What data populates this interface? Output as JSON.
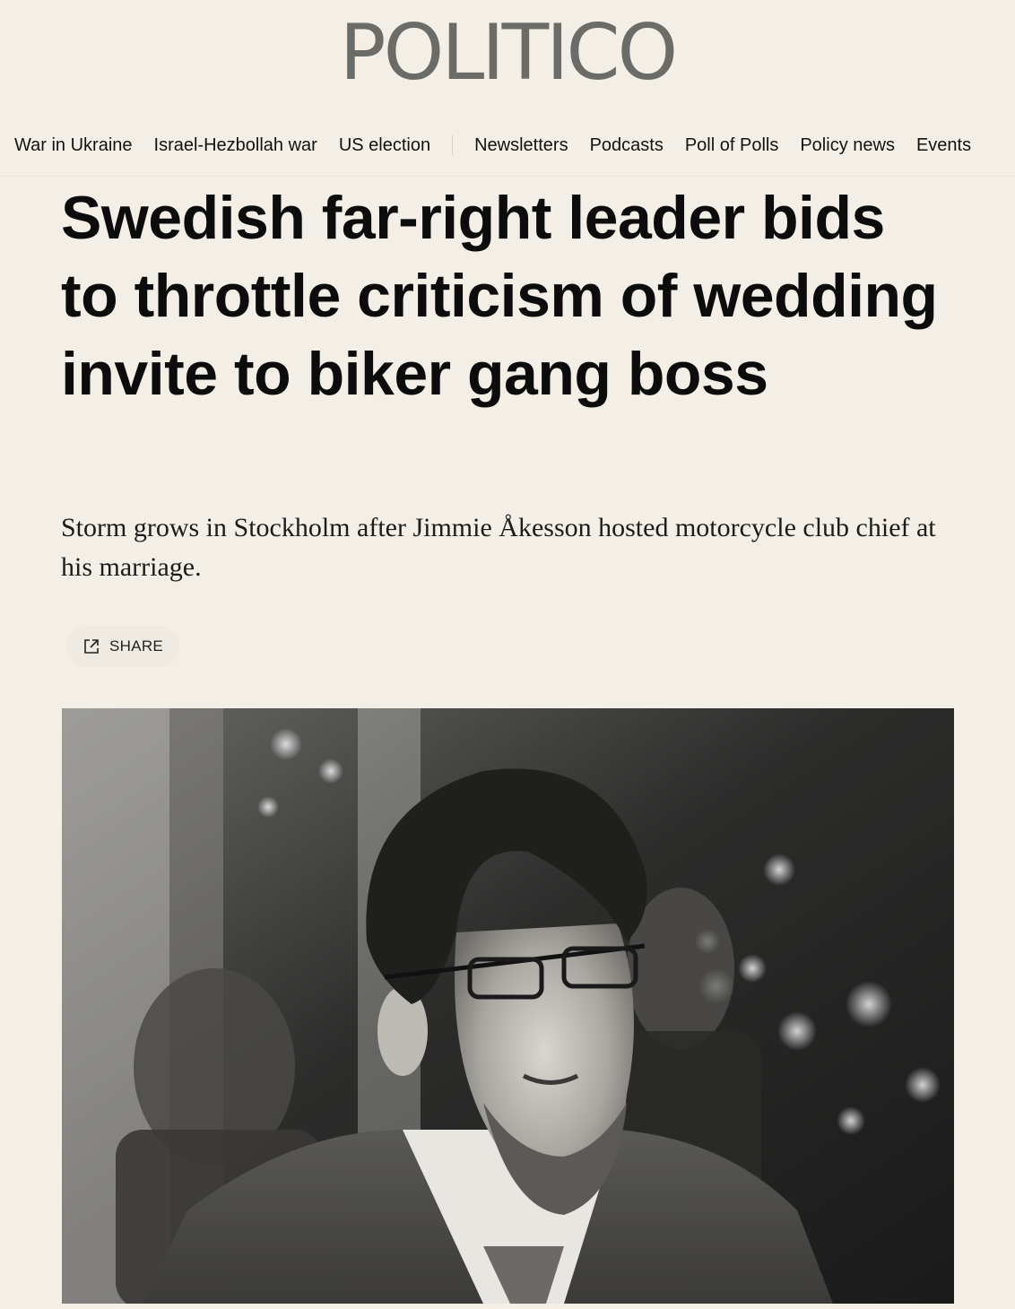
{
  "brand": {
    "logo": "POLITICO"
  },
  "nav": {
    "items": [
      "War in Ukraine",
      "Israel-Hezbollah war",
      "US election"
    ],
    "secondary_items": [
      "Newsletters",
      "Podcasts",
      "Poll of Polls",
      "Policy news",
      "Events"
    ]
  },
  "article": {
    "headline": "Swedish far-right leader bids to throttle criticism of wedding invite to biker gang boss",
    "dek": "Storm grows in Stockholm after Jimmie Åkesson hosted motorcycle club chief at his marriage.",
    "share_label": "SHARE"
  },
  "icons": {
    "share": "share-external-icon"
  },
  "colors": {
    "background": "#f3efe7",
    "logo": "#6b6b68",
    "text": "#0e0e0e"
  }
}
